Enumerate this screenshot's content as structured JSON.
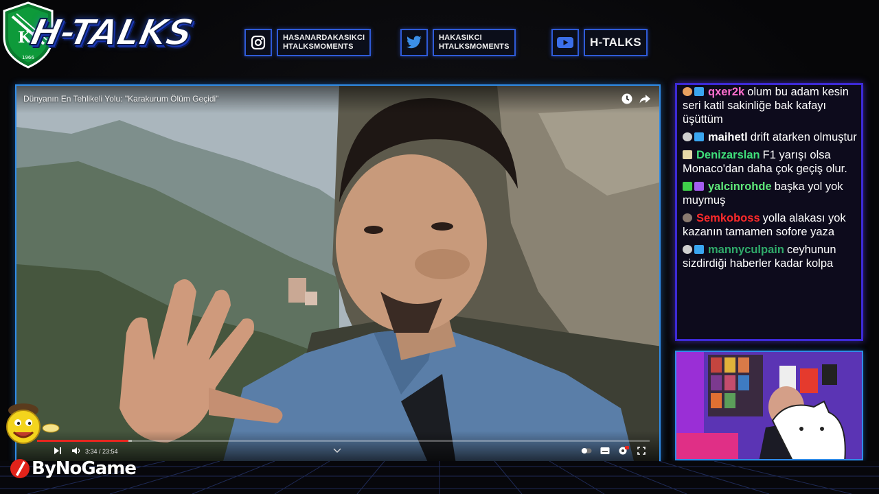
{
  "header": {
    "brand_title": "H-TALKS",
    "badge_letters": "KS",
    "badge_year": "1966",
    "social": [
      {
        "icon": "instagram-icon",
        "line1": "HASANARDAKASIKCI",
        "line2": "HTALKSMOMENTS"
      },
      {
        "icon": "twitter-icon",
        "line1": "HAKASIKCI",
        "line2": "HTALKSMOMENTS"
      },
      {
        "icon": "youtube-icon",
        "line1": "H-TALKS"
      }
    ]
  },
  "video": {
    "title": "Dünyanın En Tehlikeli Yolu: \"Karakurum Ölüm Geçidi\"",
    "current_time": "3:34",
    "duration": "23:54",
    "time_display": "3:34 / 23:54",
    "progress_fraction": 0.149,
    "buffer_fraction": 0.155,
    "progress_color": "#e8261f"
  },
  "chat": {
    "messages": [
      {
        "user": "qxer2k",
        "user_color": "#ff6fcf",
        "badges": [
          "orange-dot-badge",
          "crown-badge"
        ],
        "text": "olum bu adam kesin seri katil sakinliğe bak kafayı üşüttüm"
      },
      {
        "user": "maihetl",
        "user_color": "#ffffff",
        "badges": [
          "bits-badge",
          "crown-badge"
        ],
        "text": "drift atarken olmuştur"
      },
      {
        "user": "Denizarslan",
        "user_color": "#3fe07a",
        "badges": [
          "hamburger-badge"
        ],
        "text": "F1 yarışı olsa Monaco'dan daha çok geçiş olur."
      },
      {
        "user": "yalcinrohde",
        "user_color": "#5fe87a",
        "badges": [
          "sword-badge",
          "subscriber-badge"
        ],
        "text": "başka yol yok muymuş"
      },
      {
        "user": "Semkoboss",
        "user_color": "#ff2a2a",
        "badges": [
          "figure-badge"
        ],
        "text": "yolla alakası yok kazanın tamamen sofore yaza"
      },
      {
        "user": "mannyculpain",
        "user_color": "#2faa6a",
        "badges": [
          "bits-badge",
          "crown-badge"
        ],
        "text": "ceyhunun sizdirdiği haberler kadar kolpa"
      }
    ]
  },
  "sponsor": {
    "name": "ByNoGame"
  },
  "colors": {
    "accent_blue": "#2f5bd8",
    "chat_border": "#3d2ad6",
    "cam_border": "#2f8ce8"
  }
}
